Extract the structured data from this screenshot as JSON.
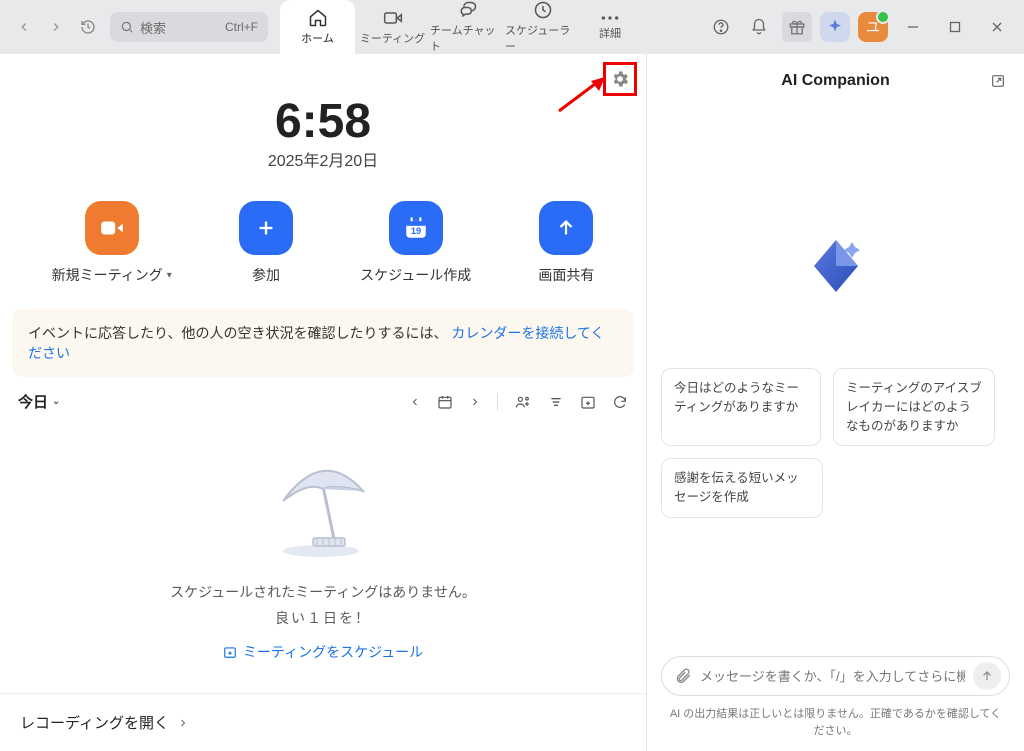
{
  "search": {
    "placeholder": "検索",
    "shortcut": "Ctrl+F"
  },
  "tabs": {
    "home": "ホーム",
    "meetings": "ミーティング",
    "team_chat": "チームチャット",
    "scheduler": "スケジューラー",
    "more": "詳細"
  },
  "avatar_initial": "ユ",
  "clock": {
    "time": "6:58",
    "date": "2025年2月20日"
  },
  "actions": {
    "new_meeting": "新規ミーティング",
    "join": "参加",
    "schedule": "スケジュール作成",
    "share": "画面共有",
    "calendar_day": "19"
  },
  "banner": {
    "text": "イベントに応答したり、他の人の空き状況を確認したりするには、",
    "link": "カレンダーを接続してください"
  },
  "today_label": "今日",
  "empty": {
    "line1": "スケジュールされたミーティングはありません。",
    "line2": "良い１日を！",
    "link": "ミーティングをスケジュール"
  },
  "recordings_label": "レコーディングを開く",
  "companion": {
    "title": "AI Companion",
    "suggestions": [
      "今日はどのようなミーティングがありますか",
      "ミーティングのアイスブレイカーにはどのようなものがありますか",
      "感謝を伝える短いメッセージを作成"
    ],
    "input_placeholder": "メッセージを書くか、「/」を入力してさらに機...",
    "disclaimer": "AI の出力結果は正しいとは限りません。正確であるかを確認してください。"
  }
}
